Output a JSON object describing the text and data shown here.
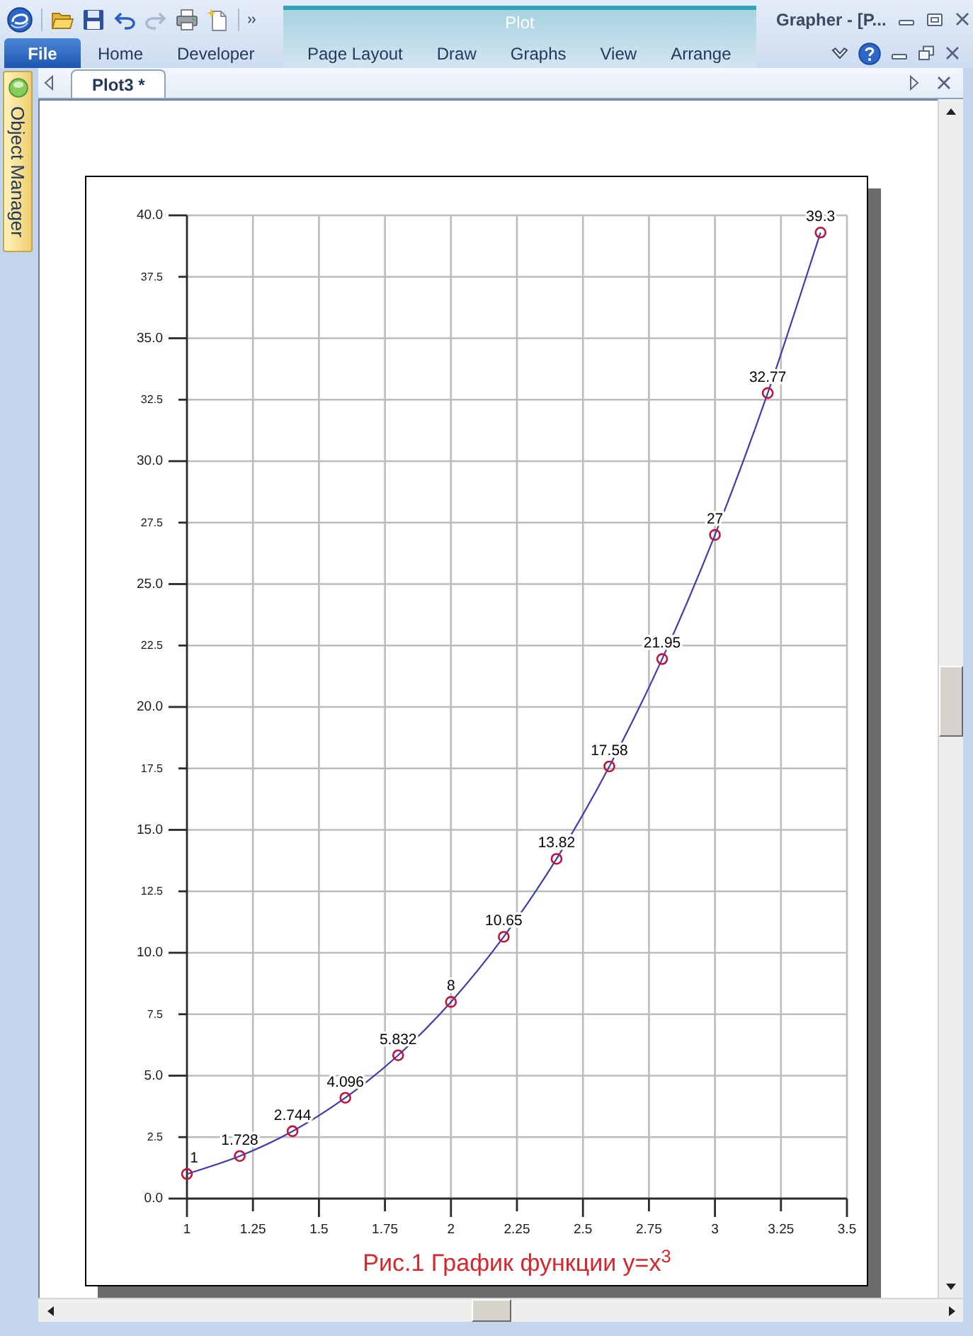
{
  "window": {
    "title": "Grapher - [P..."
  },
  "ribbon": {
    "tabs": [
      {
        "label": "File",
        "kind": "file",
        "selected": false
      },
      {
        "label": "Home",
        "kind": "tab",
        "selected": false
      },
      {
        "label": "Developer",
        "kind": "tab",
        "selected": false
      }
    ],
    "context_group": {
      "label": "Plot",
      "tabs": [
        {
          "label": "Page Layout",
          "selected": false
        },
        {
          "label": "Draw",
          "selected": false
        },
        {
          "label": "Graphs",
          "selected": false
        },
        {
          "label": "View",
          "selected": false
        },
        {
          "label": "Arrange",
          "selected": false
        }
      ]
    }
  },
  "sidebar": {
    "tabs": [
      {
        "label": "Object Manager"
      }
    ]
  },
  "documents": {
    "tabs": [
      {
        "label": "Plot3 *",
        "selected": true
      }
    ]
  },
  "plot": {
    "chart_data": {
      "type": "line",
      "title": "Рис.1 График функции y=x$^{3}$",
      "grid": true,
      "x": [
        1,
        1.2,
        1.4,
        1.6,
        1.8,
        2,
        2.2,
        2.4,
        2.6,
        2.8,
        3,
        3.2,
        3.4
      ],
      "series": [
        {
          "color": "#3c3cb4",
          "marker": "circle",
          "values": [
            1,
            1.73,
            2.74,
            4.1,
            5.83,
            8,
            10.65,
            13.82,
            17.58,
            21.95,
            27,
            32.77,
            39.3
          ]
        }
      ],
      "value_labels": [
        "1",
        "1.728",
        "2.744",
        "4.096",
        "5.832",
        "8",
        "10.65",
        "13.82",
        "17.58",
        "21.95",
        "27",
        "32.77",
        "39.3"
      ],
      "xlim": [
        1,
        3.5
      ],
      "ylim": [
        0,
        40
      ],
      "xticks": [
        1,
        1.25,
        1.5,
        1.75,
        2,
        2.25,
        2.5,
        2.75,
        3,
        3.25,
        3.5
      ],
      "yticks": [
        {
          "value": 0,
          "label": "0.0"
        },
        {
          "value": 2.5,
          "label": "2.5"
        },
        {
          "value": 5,
          "label": "5.0"
        },
        {
          "value": 7.5,
          "label": "7.5"
        },
        {
          "value": 10,
          "label": "10.0"
        },
        {
          "value": 12.5,
          "label": "12.5"
        },
        {
          "value": 15,
          "label": "15.0"
        },
        {
          "value": 17.5,
          "label": "17.5"
        },
        {
          "value": 20,
          "label": "20.0"
        },
        {
          "value": 22.5,
          "label": "22.5"
        },
        {
          "value": 25,
          "label": "25.0"
        },
        {
          "value": 27.5,
          "label": "27.5"
        },
        {
          "value": 30,
          "label": "30.0"
        },
        {
          "value": 32.5,
          "label": "32.5"
        },
        {
          "value": 35,
          "label": "35.0"
        },
        {
          "value": 37.5,
          "label": "37.5"
        },
        {
          "value": 40,
          "label": "40.0"
        }
      ]
    }
  }
}
